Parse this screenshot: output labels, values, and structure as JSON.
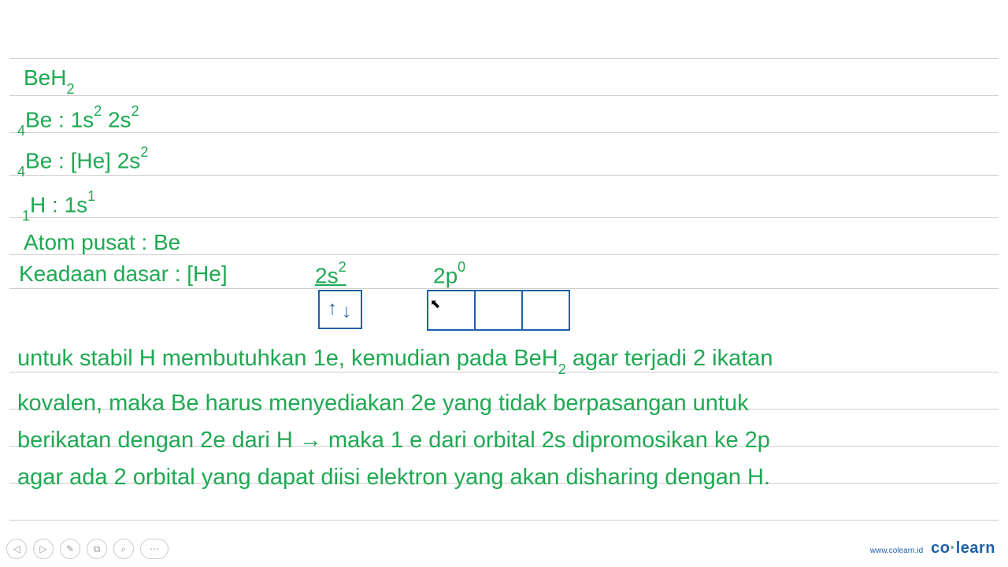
{
  "lines": {
    "l1_compound_pre": "BeH",
    "l1_compound_sub": "2",
    "l2_presub": "4",
    "l2_el": "Be : 1s",
    "l2_sup1": "2",
    "l2_mid": " 2s",
    "l2_sup2": "2",
    "l3_presub": "4",
    "l3_el": "Be : [He] 2s",
    "l3_sup": "2",
    "l4_presub": "1",
    "l4_el": "H : 1s",
    "l4_sup": "1",
    "l5": "Atom pusat : Be",
    "l6_label": "Keadaan dasar : [He]",
    "l6_orb1_pre": "2s",
    "l6_orb1_sup": "2",
    "l6_orb2_pre": "2p",
    "l6_orb2_sup": "0"
  },
  "notes": {
    "n1a": "untuk stabil H membutuhkan 1e, kemudian pada BeH",
    "n1sub": "2",
    "n1b": " agar terjadi 2 ikatan",
    "n2": "kovalen, maka Be harus menyediakan 2e yang tidak berpasangan untuk",
    "n3": "berikatan dengan 2e dari H → maka 1 e dari orbital 2s dipromosikan ke 2p",
    "n4": " agar ada 2 orbital yang dapat diisi elektron yang akan disharing dengan H."
  },
  "footer": {
    "url": "www.colearn.id",
    "logo_pre": "co",
    "logo_dot": "·",
    "logo_post": "learn"
  },
  "toolbar": {
    "prev": "◁",
    "next": "▷",
    "pen": "✎",
    "copy": "⧉",
    "zoom": "⌕",
    "more": "⋯"
  }
}
